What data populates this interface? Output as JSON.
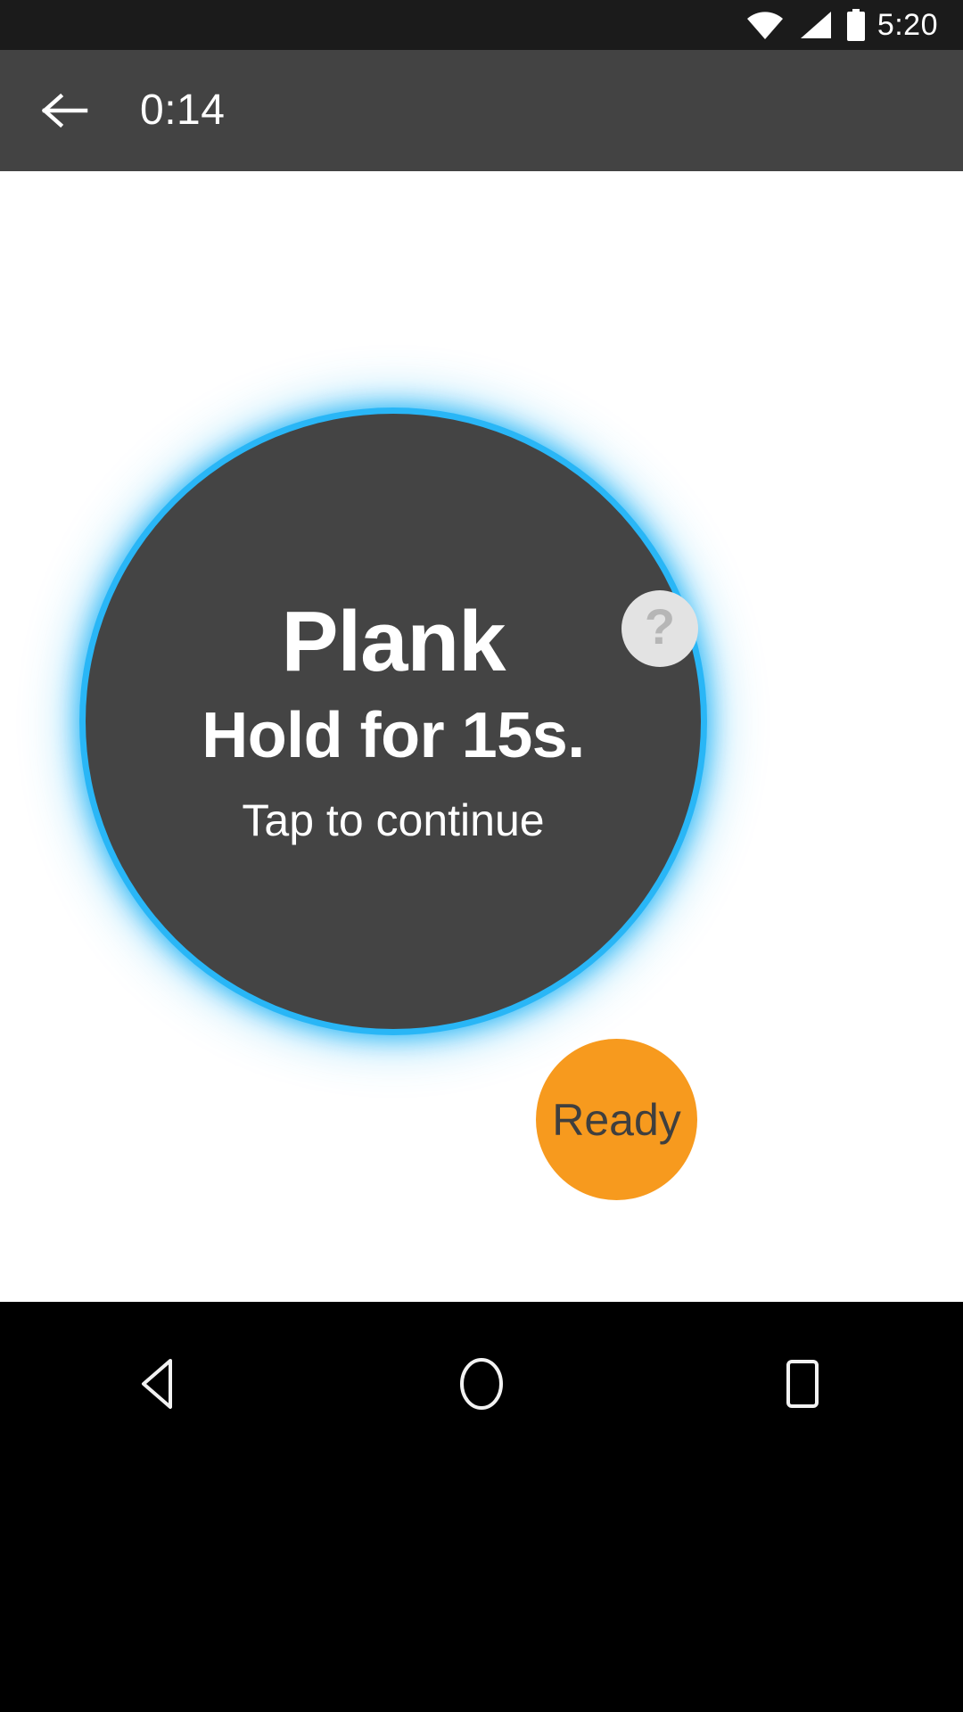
{
  "status_bar": {
    "time": "5:20",
    "icons": [
      "wifi-icon",
      "signal-icon",
      "battery-icon"
    ]
  },
  "app_bar": {
    "back_icon": "back-arrow-icon",
    "timer": "0:14"
  },
  "main": {
    "exercise_name": "Plank",
    "instruction": "Hold for 15s.",
    "hint": "Tap to continue",
    "help_label": "?",
    "ready_label": "Ready",
    "colors": {
      "circle_fill": "#444444",
      "glow": "#29b6f6",
      "ready_fill": "#f79a1e",
      "ready_text": "#3f3f3f",
      "help_fill": "#e3e3e3",
      "help_text": "#b6b6b6"
    }
  },
  "nav_bar": {
    "back": "nav-back-icon",
    "home": "nav-home-icon",
    "recents": "nav-recents-icon"
  }
}
